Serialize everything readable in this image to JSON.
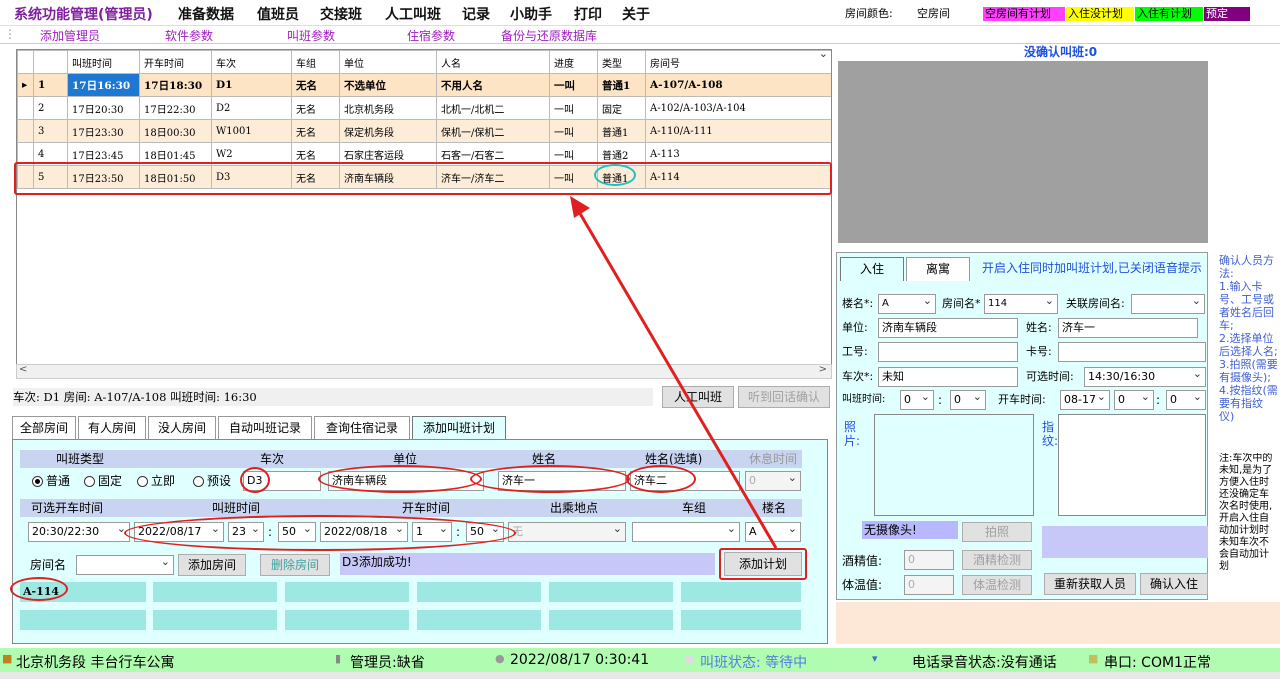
{
  "menu": {
    "title": "系统功能管理(管理员)",
    "items": [
      "准备数据",
      "值班员",
      "交接班",
      "人工叫班",
      "记录",
      "小助手",
      "打印",
      "关于"
    ]
  },
  "room_legend": {
    "label": "房间颜色:",
    "items": [
      {
        "text": "空房间",
        "color": "#ffffff"
      },
      {
        "text": "空房间有计划",
        "color": "#ff40ff"
      },
      {
        "text": "入住没计划",
        "color": "#ffff00"
      },
      {
        "text": "入住有计划",
        "color": "#00ff00"
      },
      {
        "text": "预定",
        "color": "#800080"
      }
    ]
  },
  "submenu": [
    "添加管理员",
    "软件参数",
    "叫班参数",
    "住宿参数",
    "备份与还原数据库"
  ],
  "grid": {
    "headers": [
      "",
      "叫班时间",
      "开车时间",
      "车次",
      "车组",
      "单位",
      "人名",
      "进度",
      "类型",
      "房间号"
    ],
    "rows": [
      {
        "mark": "▸",
        "no": "1",
        "call": "17日16:30",
        "dep": "17日18:30",
        "train": "D1",
        "group": "无名",
        "unit": "不选单位",
        "name": "不用人名",
        "prog": "一叫",
        "type": "普通1",
        "room": "A-107/A-108"
      },
      {
        "mark": "",
        "no": "2",
        "call": "17日20:30",
        "dep": "17日22:30",
        "train": "D2",
        "group": "无名",
        "unit": "北京机务段",
        "name": "北机一/北机二",
        "prog": "一叫",
        "type": "固定",
        "room": "A-102/A-103/A-104"
      },
      {
        "mark": "",
        "no": "3",
        "call": "17日23:30",
        "dep": "18日00:30",
        "train": "W1001",
        "group": "无名",
        "unit": "保定机务段",
        "name": "保机一/保机二",
        "prog": "一叫",
        "type": "普通1",
        "room": "A-110/A-111"
      },
      {
        "mark": "",
        "no": "4",
        "call": "17日23:45",
        "dep": "18日01:45",
        "train": "W2",
        "group": "无名",
        "unit": "石家庄客运段",
        "name": "石客一/石客二",
        "prog": "一叫",
        "type": "普通2",
        "room": "A-113"
      },
      {
        "mark": "",
        "no": "5",
        "call": "17日23:50",
        "dep": "18日01:50",
        "train": "D3",
        "group": "无名",
        "unit": "济南车辆段",
        "name": "济车一/济车二",
        "prog": "一叫",
        "type": "普通1",
        "room": "A-114"
      }
    ]
  },
  "info": {
    "line": "车次: D1 房间: A-107/A-108  叫班时间: 16:30",
    "manual_call": "人工叫班",
    "confirm_reply": "听到回话确认"
  },
  "tabs": [
    "全部房间",
    "有人房间",
    "没人房间",
    "自动叫班记录",
    "查询住宿记录",
    "添加叫班计划"
  ],
  "plan": {
    "h_calltype": "叫班类型",
    "h_train": "车次",
    "h_unit": "单位",
    "h_name": "姓名",
    "h_name2": "姓名(选填)",
    "h_rest": "休息时间",
    "radios": [
      "普通",
      "固定",
      "立即",
      "预设"
    ],
    "train": "D3",
    "unit": "济南车辆段",
    "name": "济车一",
    "name2": "济车二",
    "rest": "0",
    "h_avail": "可选开车时间",
    "h_calltime": "叫班时间",
    "h_deptime": "开车时间",
    "h_board": "出乘地点",
    "h_group": "车组",
    "h_building": "楼名",
    "avail": "20:30/22:30",
    "call_date": "2022/08/17",
    "call_h": "23",
    "call_m": "50",
    "dep_date": "2022/08/18",
    "dep_h": "1",
    "dep_m": "50",
    "board": "无",
    "group": "",
    "building": "A",
    "room_label": "房间名",
    "room_value": "",
    "add_room": "添加房间",
    "del_room": "删除房间",
    "message": "D3添加成功!",
    "add_plan": "添加计划",
    "room_chip": "A-114"
  },
  "right": {
    "unconfirmed": "没确认叫班:0",
    "tabs": [
      "入住",
      "离寓"
    ],
    "notice": "开启入住同时加叫班计划,已关闭语音提示",
    "building_label": "楼名*:",
    "building": "A",
    "room_label": "房间名*",
    "room": "114",
    "rel_label": "关联房间名:",
    "rel": "",
    "unit_label": "单位:",
    "unit": "济南车辆段",
    "name_label": "姓名:",
    "name": "济车一",
    "job_label": "工号:",
    "job": "",
    "card_label": "卡号:",
    "card": "",
    "train_label": "车次*:",
    "train": "未知",
    "optional_label": "可选时间:",
    "optional": "14:30/16:30",
    "calltime_label": "叫班时间:",
    "call_h": "0",
    "call_m": "0",
    "dep_label": "开车时间:",
    "dep_date": "08-17",
    "dep_h": "0",
    "dep_m": "0",
    "photo_label": "照片:",
    "finger_label": "指纹:",
    "no_camera": "无摄像头!",
    "photo_btn": "拍照",
    "alcohol_label": "酒精值:",
    "alcohol": "0",
    "alcohol_btn": "酒精检测",
    "temp_label": "体温值:",
    "temp": "0",
    "temp_btn": "体温检测",
    "refetch": "重新获取人员",
    "confirm": "确认入住"
  },
  "side_help": "确认人员方法:\n1.输入卡号、工号或者姓名后回车;\n2.选择单位后选择人名;\n3.拍照(需要有摄像头);\n4.按指纹(需要有指纹仪)",
  "side_note": "注:车次中的未知,是为了方便入住时还没确定车次名时使用,开启入住自动加计划时未知车次不会自动加计划",
  "status": {
    "station": "北京机务段 丰台行车公寓",
    "admin": "管理员:缺省",
    "datetime": "2022/08/17 0:30:41",
    "call_state": "叫班状态: 等待中",
    "phone": "电话录音状态:没有通话",
    "port": "串口: COM1正常"
  }
}
